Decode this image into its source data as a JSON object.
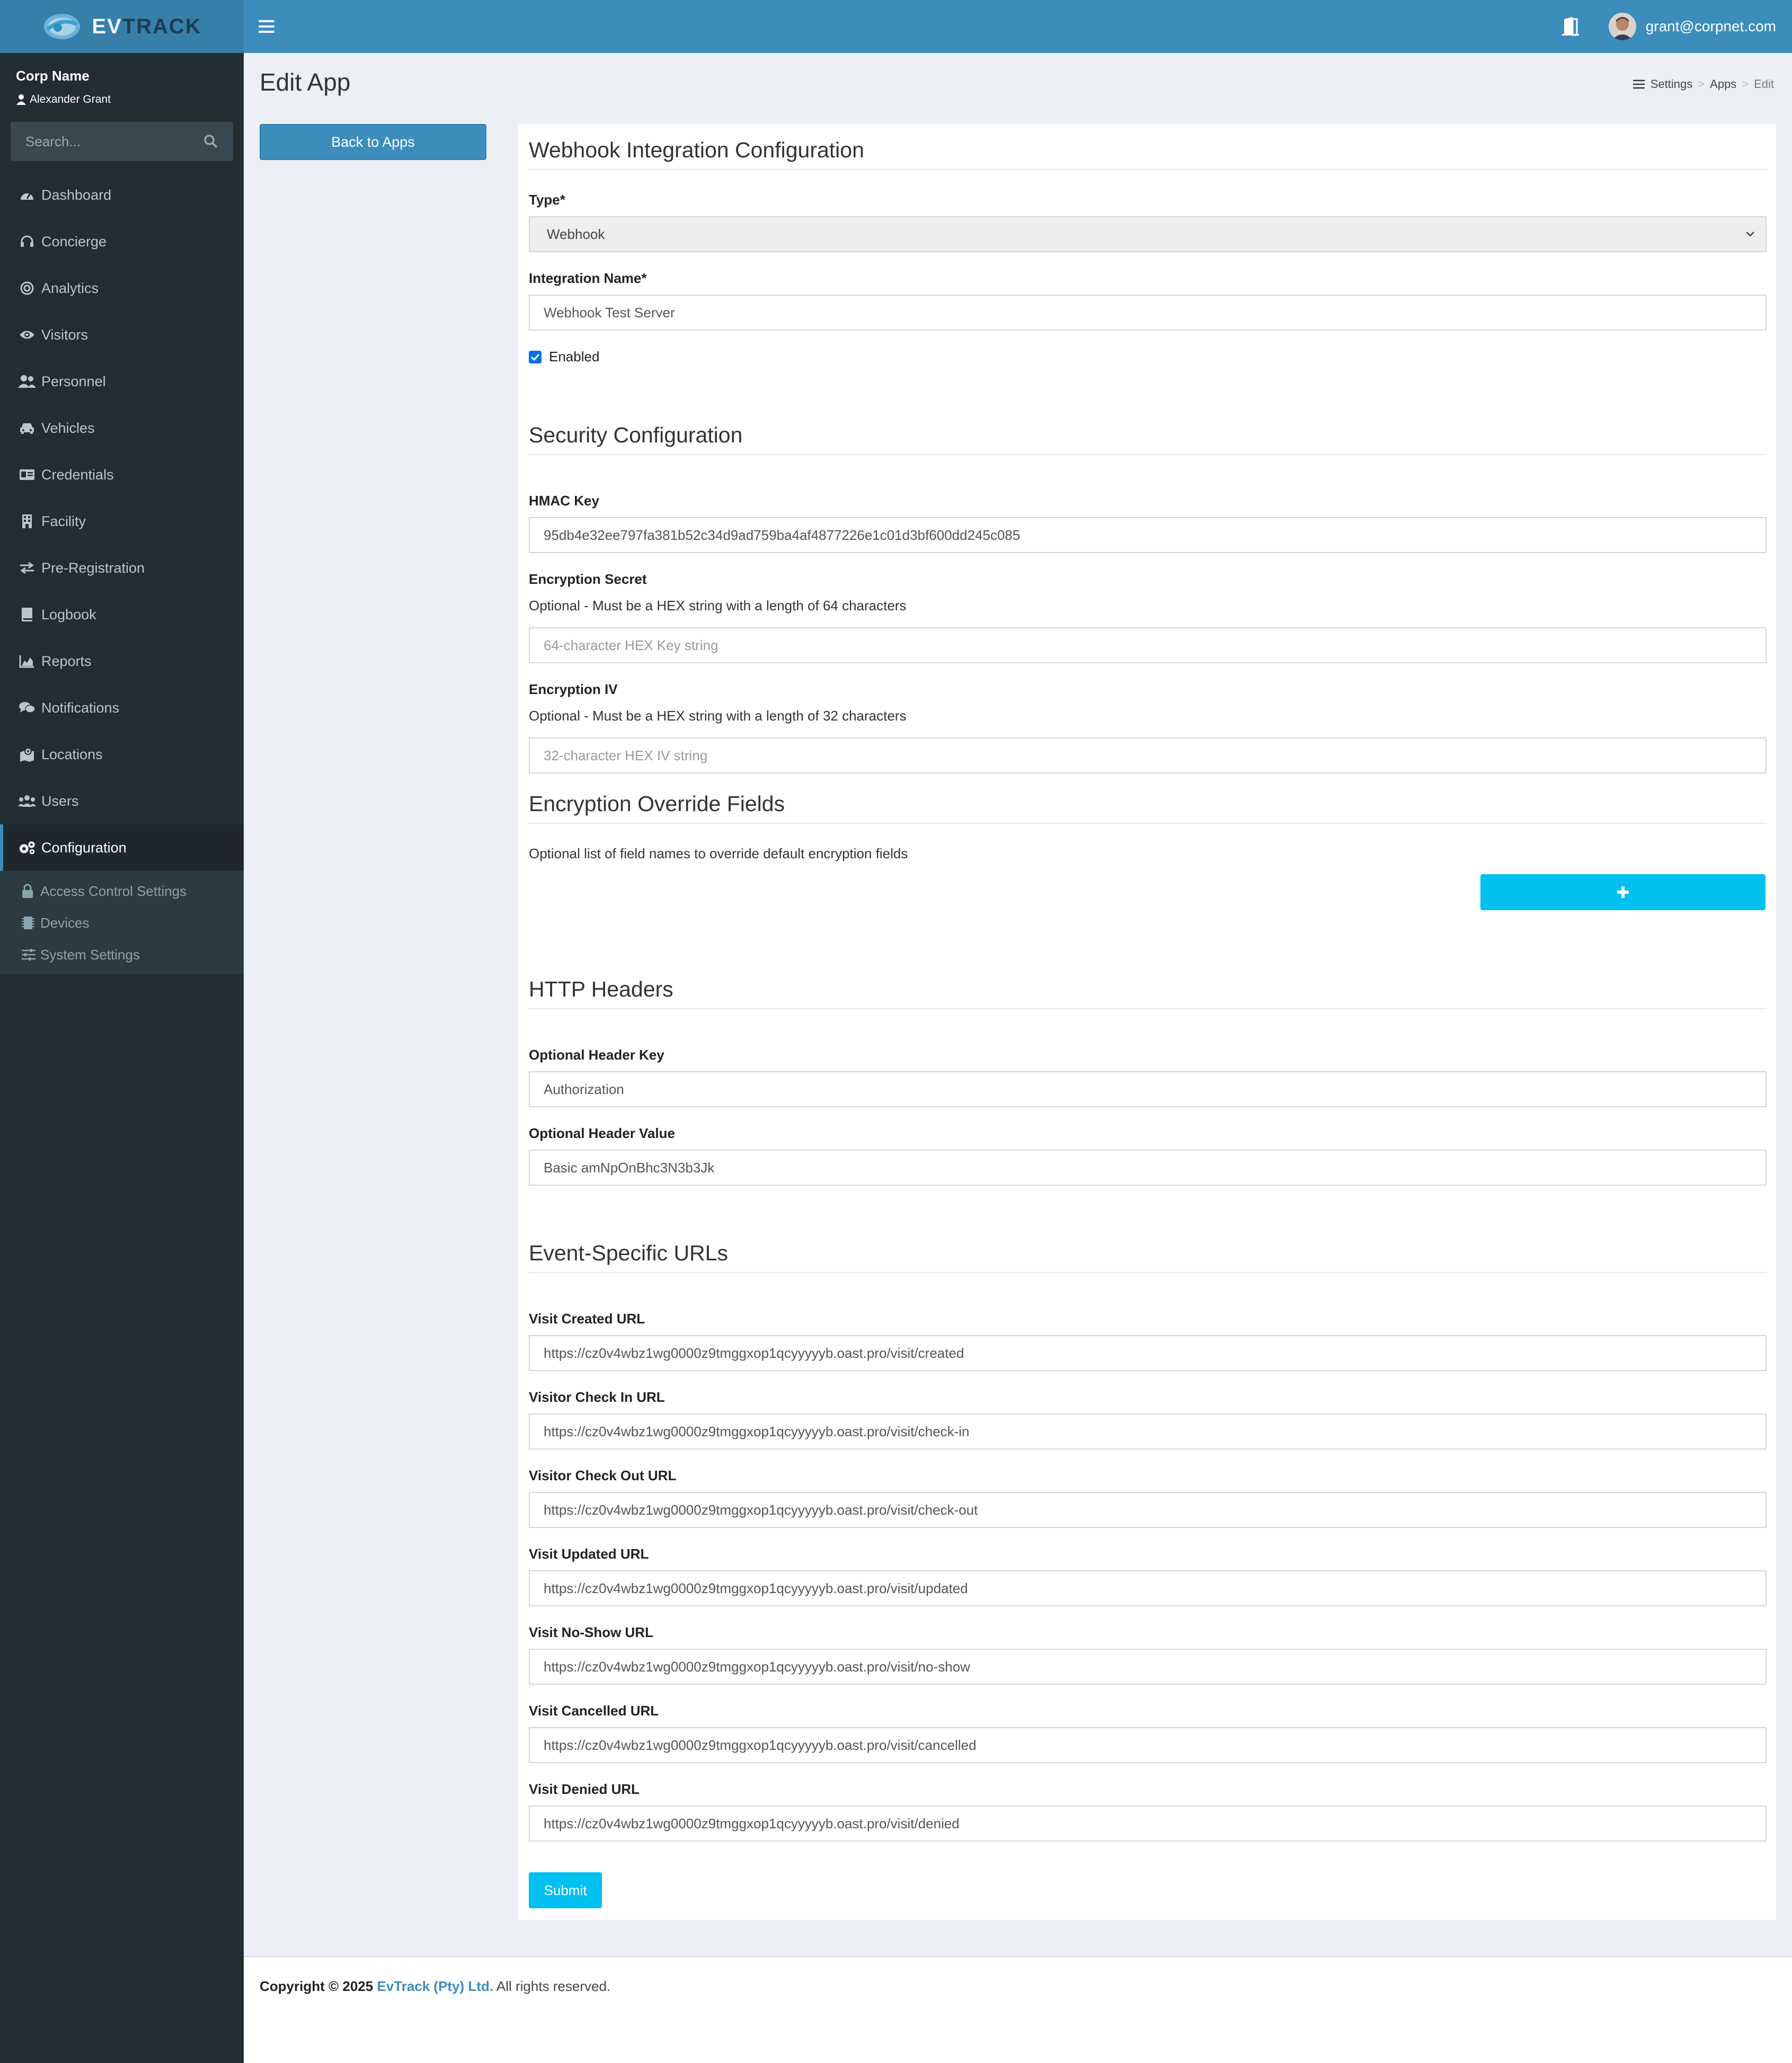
{
  "header": {
    "logo_prefix": "EV",
    "logo_suffix": "TRACK",
    "user_email": "grant@corpnet.com"
  },
  "sidebar": {
    "corp_name": "Corp Name",
    "user_name": "Alexander Grant",
    "search_placeholder": "Search...",
    "items": [
      {
        "label": "Dashboard",
        "icon": "dashboard-icon"
      },
      {
        "label": "Concierge",
        "icon": "headset-icon"
      },
      {
        "label": "Analytics",
        "icon": "target-icon"
      },
      {
        "label": "Visitors",
        "icon": "eye-icon"
      },
      {
        "label": "Personnel",
        "icon": "users-icon"
      },
      {
        "label": "Vehicles",
        "icon": "car-icon"
      },
      {
        "label": "Credentials",
        "icon": "id-card-icon"
      },
      {
        "label": "Facility",
        "icon": "building-icon"
      },
      {
        "label": "Pre-Registration",
        "icon": "exchange-icon"
      },
      {
        "label": "Logbook",
        "icon": "book-icon"
      },
      {
        "label": "Reports",
        "icon": "area-chart-icon"
      },
      {
        "label": "Notifications",
        "icon": "comments-icon"
      },
      {
        "label": "Locations",
        "icon": "map-icon"
      },
      {
        "label": "Users",
        "icon": "group-icon"
      },
      {
        "label": "Configuration",
        "icon": "gears-icon"
      }
    ],
    "subitems": [
      {
        "label": "Access Control Settings",
        "icon": "lock-icon"
      },
      {
        "label": "Devices",
        "icon": "chip-icon"
      },
      {
        "label": "System Settings",
        "icon": "sliders-icon"
      }
    ]
  },
  "page": {
    "title": "Edit App",
    "breadcrumb": [
      "Settings",
      "Apps",
      "Edit"
    ],
    "back_button": "Back to Apps"
  },
  "form": {
    "section_webhook": "Webhook Integration Configuration",
    "type_label": "Type*",
    "type_value": "Webhook",
    "name_label": "Integration Name*",
    "name_value": "Webhook Test Server",
    "enabled_label": "Enabled",
    "section_security": "Security Configuration",
    "hmac_label": "HMAC Key",
    "hmac_value": "95db4e32ee797fa381b52c34d9ad759ba4af4877226e1c01d3bf600dd245c085",
    "secret_label": "Encryption Secret",
    "secret_help": "Optional - Must be a HEX string with a length of 64 characters",
    "secret_placeholder": "64-character HEX Key string",
    "iv_label": "Encryption IV",
    "iv_help": "Optional - Must be a HEX string with a length of 32 characters",
    "iv_placeholder": "32-character HEX IV string",
    "section_override": "Encryption Override Fields",
    "override_help": "Optional list of field names to override default encryption fields",
    "section_headers": "HTTP Headers",
    "header_key_label": "Optional Header Key",
    "header_key_value": "Authorization",
    "header_value_label": "Optional Header Value",
    "header_value_value": "Basic amNpOnBhc3N3b3Jk",
    "section_urls": "Event-Specific URLs",
    "urls": [
      {
        "label": "Visit Created URL",
        "value": "https://cz0v4wbz1wg0000z9tmggxop1qcyyyyyb.oast.pro/visit/created"
      },
      {
        "label": "Visitor Check In URL",
        "value": "https://cz0v4wbz1wg0000z9tmggxop1qcyyyyyb.oast.pro/visit/check-in"
      },
      {
        "label": "Visitor Check Out URL",
        "value": "https://cz0v4wbz1wg0000z9tmggxop1qcyyyyyb.oast.pro/visit/check-out"
      },
      {
        "label": "Visit Updated URL",
        "value": "https://cz0v4wbz1wg0000z9tmggxop1qcyyyyyb.oast.pro/visit/updated"
      },
      {
        "label": "Visit No-Show URL",
        "value": "https://cz0v4wbz1wg0000z9tmggxop1qcyyyyyb.oast.pro/visit/no-show"
      },
      {
        "label": "Visit Cancelled URL",
        "value": "https://cz0v4wbz1wg0000z9tmggxop1qcyyyyyb.oast.pro/visit/cancelled"
      },
      {
        "label": "Visit Denied URL",
        "value": "https://cz0v4wbz1wg0000z9tmggxop1qcyyyyyb.oast.pro/visit/denied"
      }
    ],
    "submit_label": "Submit"
  },
  "footer": {
    "copyright": "Copyright © 2025",
    "brand": "EvTrack (Pty) Ltd.",
    "rights": "All rights reserved."
  },
  "colors": {
    "header": "#3c8dbc",
    "sidebar": "#222d32",
    "accent": "#00c0ef"
  }
}
